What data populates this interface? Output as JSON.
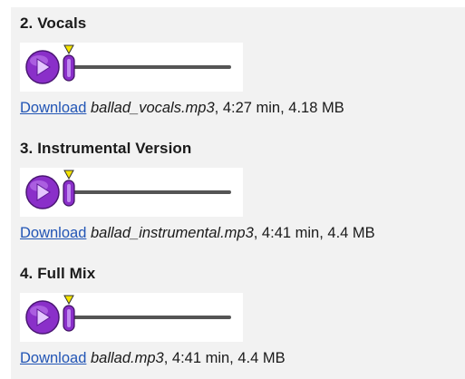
{
  "tracks": [
    {
      "title": "2. Vocals",
      "player": {
        "play_icon": "play-icon",
        "position_fraction": 0
      },
      "download": {
        "link_label": "Download",
        "filename": "ballad_vocals.mp3",
        "details": ", 4:27 min, 4.18 MB"
      }
    },
    {
      "title": "3. Instrumental Version",
      "player": {
        "play_icon": "play-icon",
        "position_fraction": 0
      },
      "download": {
        "link_label": "Download",
        "filename": "ballad_instrumental.mp3",
        "details": ", 4:41 min, 4.4 MB"
      }
    },
    {
      "title": "4. Full Mix",
      "player": {
        "play_icon": "play-icon",
        "position_fraction": 0
      },
      "download": {
        "link_label": "Download",
        "filename": "ballad.mp3",
        "details": ", 4:41 min, 4.4 MB"
      }
    }
  ],
  "colors": {
    "panel_bg": "#f2f2f2",
    "link": "#2255b5",
    "play_button": "#8a2fc9",
    "slider_track": "#555555",
    "position_marker": "#f5e400"
  }
}
